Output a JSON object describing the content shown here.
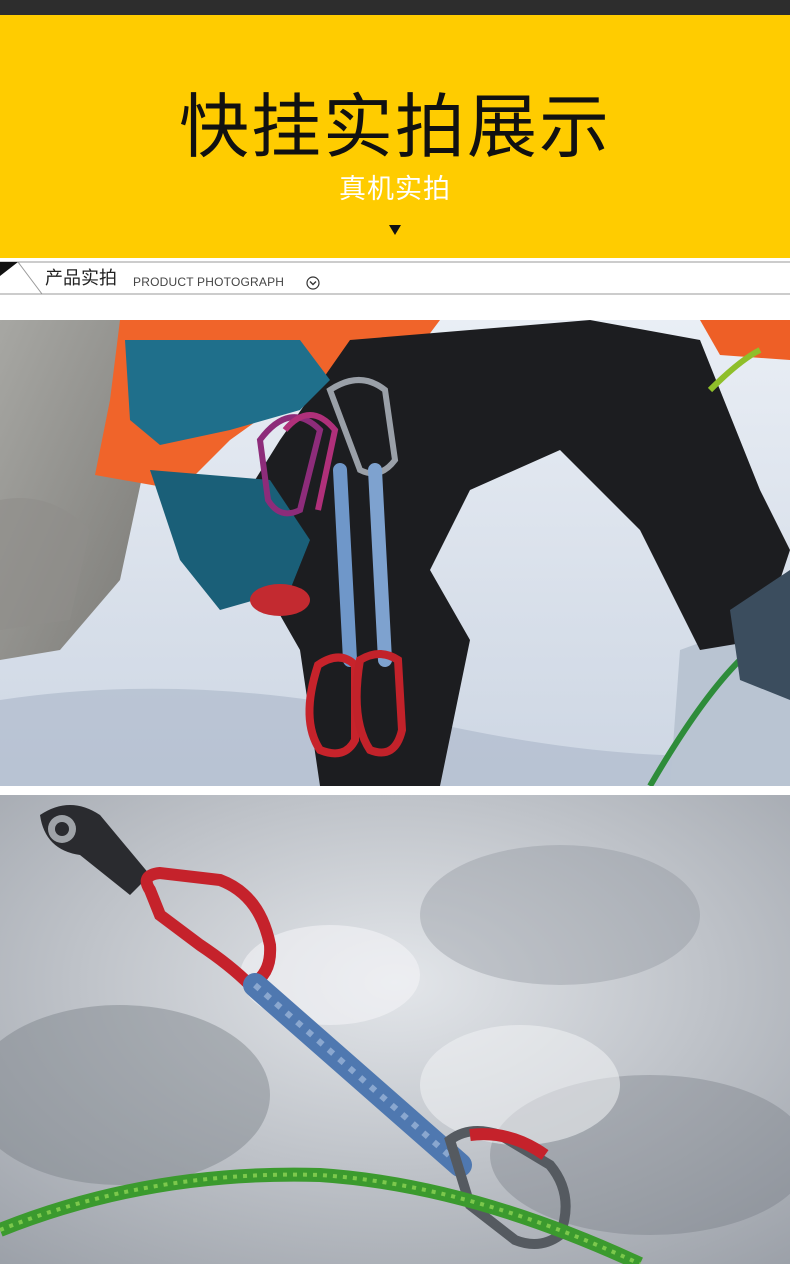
{
  "banner": {
    "title": "快挂实拍展示",
    "subtitle": "真机实拍",
    "background_color": "#ffcc00"
  },
  "section": {
    "title_cn": "产品实拍",
    "title_en": "PRODUCT PHOTOGRAPH",
    "icon": "chevron-down-circle-icon"
  },
  "photos": [
    {
      "name": "climber-harness-photo"
    },
    {
      "name": "quickdraw-on-ice-photo"
    }
  ]
}
